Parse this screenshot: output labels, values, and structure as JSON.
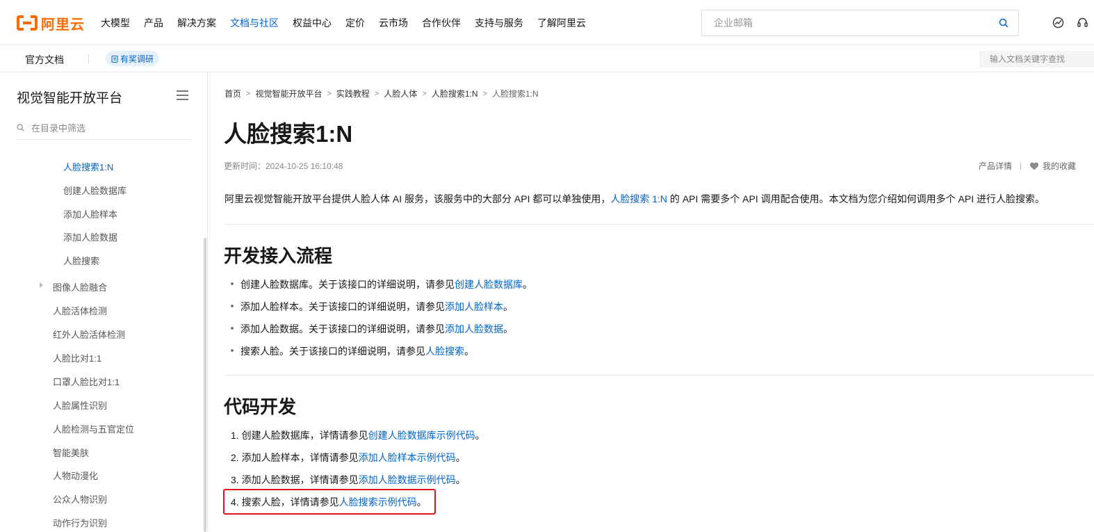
{
  "brand": {
    "logo_text": "阿里云",
    "color": "#ff6a00"
  },
  "topnav": {
    "items": [
      "大模型",
      "产品",
      "解决方案",
      "文档与社区",
      "权益中心",
      "定价",
      "云市场",
      "合作伙伴",
      "支持与服务",
      "了解阿里云"
    ],
    "active_index": 3,
    "search_placeholder": "企业邮箱"
  },
  "subbar": {
    "title": "官方文档",
    "survey_label": "有奖调研",
    "doc_search_placeholder": "输入文档关键字查找"
  },
  "sidebar": {
    "title": "视觉智能开放平台",
    "filter_placeholder": "在目录中筛选",
    "items": [
      {
        "label": "人脸搜索1:N",
        "active": true
      },
      {
        "label": "创建人脸数据库"
      },
      {
        "label": "添加人脸样本"
      },
      {
        "label": "添加人脸数据"
      },
      {
        "label": "人脸搜索"
      },
      {
        "label": "图像人脸融合",
        "expandable": true
      },
      {
        "label": "人脸活体检测"
      },
      {
        "label": "红外人脸活体检测"
      },
      {
        "label": "人脸比对1:1"
      },
      {
        "label": "口罩人脸比对1:1"
      },
      {
        "label": "人脸属性识别"
      },
      {
        "label": "人脸检测与五官定位"
      },
      {
        "label": "智能美肤"
      },
      {
        "label": "人物动漫化"
      },
      {
        "label": "公众人物识别"
      },
      {
        "label": "动作行为识别"
      }
    ]
  },
  "breadcrumb": [
    "首页",
    "视觉智能开放平台",
    "实践教程",
    "人脸人体",
    "人脸搜索1:N",
    "人脸搜索1:N"
  ],
  "article": {
    "title": "人脸搜索1:N",
    "updated": "更新时间：2024-10-25 16:10:48",
    "product_detail": "产品详情",
    "favorite": "我的收藏",
    "intro_before": "阿里云视觉智能开放平台提供人脸人体 AI 服务，该服务中的大部分 API 都可以单独使用，",
    "intro_link": "人脸搜索 1:N",
    "intro_after": " 的 API 需要多个 API 调用配合使用。本文档为您介绍如何调用多个 API 进行人脸搜索。",
    "section1": {
      "heading": "开发接入流程",
      "items": [
        {
          "text": "创建人脸数据库。关于该接口的详细说明，请参见",
          "link": "创建人脸数据库",
          "end": "。"
        },
        {
          "text": "添加人脸样本。关于该接口的详细说明，请参见",
          "link": "添加人脸样本",
          "end": "。"
        },
        {
          "text": "添加人脸数据。关于该接口的详细说明，请参见",
          "link": "添加人脸数据",
          "end": "。"
        },
        {
          "text": "搜索人脸。关于该接口的详细说明，请参见",
          "link": "人脸搜索",
          "end": "。"
        }
      ]
    },
    "section2": {
      "heading": "代码开发",
      "items": [
        {
          "num": "1.",
          "text": "创建人脸数据库，详情请参见",
          "link": "创建人脸数据库示例代码",
          "end": "。"
        },
        {
          "num": "2.",
          "text": "添加人脸样本，详情请参见",
          "link": "添加人脸样本示例代码",
          "end": "。"
        },
        {
          "num": "3.",
          "text": "添加人脸数据，详情请参见",
          "link": "添加人脸数据示例代码",
          "end": "。"
        },
        {
          "num": "4.",
          "text": "搜索人脸，详情请参见",
          "link": "人脸搜索示例代码",
          "end": "。"
        }
      ]
    }
  },
  "colors": {
    "link": "#0064c8",
    "highlight": "#e4131b"
  },
  "icons": [
    "search-icon",
    "globe-icon",
    "headset-icon",
    "survey-icon",
    "menu-icon",
    "heart-icon",
    "caret-right-icon"
  ]
}
